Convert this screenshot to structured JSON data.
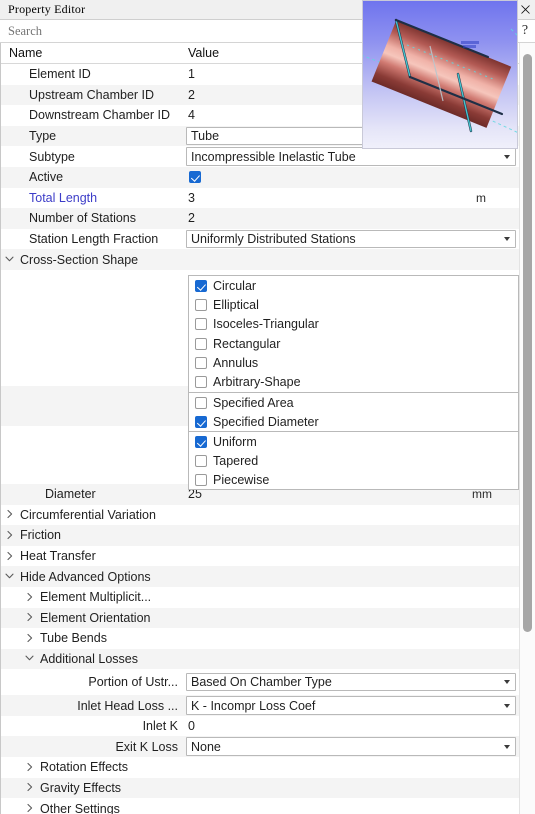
{
  "window": {
    "title": "Property Editor",
    "pin_icon": "pin-icon",
    "close_icon": "close-icon",
    "help_icon": "?"
  },
  "search": {
    "placeholder": "Search",
    "value": ""
  },
  "columns": {
    "name": "Name",
    "value": "Value"
  },
  "rows": [
    {
      "name": "Element ID",
      "value": "1",
      "kind": "text",
      "indent": 1
    },
    {
      "name": "Upstream Chamber ID",
      "value": "2",
      "kind": "text",
      "indent": 1
    },
    {
      "name": "Downstream Chamber ID",
      "value": "4",
      "kind": "text",
      "indent": 1
    },
    {
      "name": "Type",
      "value": "Tube",
      "kind": "combo-noarrow",
      "indent": 1
    },
    {
      "name": "Subtype",
      "value": "Incompressible Inelastic Tube",
      "kind": "combo",
      "indent": 1
    },
    {
      "name": "Active",
      "value": "",
      "kind": "checkbox",
      "checked": true,
      "indent": 1
    },
    {
      "name": "Total Length",
      "value": "3",
      "kind": "text",
      "indent": 1,
      "label_color": "blue",
      "unit": "m"
    },
    {
      "name": "Number of Stations",
      "value": "2",
      "kind": "text",
      "indent": 1
    },
    {
      "name": "Station Length Fraction",
      "value": "Uniformly Distributed Stations",
      "kind": "combo",
      "indent": 1
    }
  ],
  "cross_section": {
    "label": "Cross-Section Shape",
    "expanded": true,
    "shape_options": [
      {
        "label": "Circular",
        "checked": true
      },
      {
        "label": "Elliptical",
        "checked": false
      },
      {
        "label": "Isoceles-Triangular",
        "checked": false
      },
      {
        "label": "Rectangular",
        "checked": false
      },
      {
        "label": "Annulus",
        "checked": false
      },
      {
        "label": "Arbitrary-Shape",
        "checked": false
      }
    ],
    "sizing_options": [
      {
        "label": "Specified Area",
        "checked": false
      },
      {
        "label": "Specified Diameter",
        "checked": true
      }
    ],
    "variation_options": [
      {
        "label": "Uniform",
        "checked": true
      },
      {
        "label": "Tapered",
        "checked": false
      },
      {
        "label": "Piecewise",
        "checked": false
      }
    ],
    "diameter": {
      "name": "Diameter",
      "value": "25",
      "unit": "mm"
    }
  },
  "groups": [
    {
      "label": "Circumferential Variation",
      "expanded": false,
      "indent": 0
    },
    {
      "label": "Friction",
      "expanded": false,
      "indent": 0
    },
    {
      "label": "Heat Transfer",
      "expanded": false,
      "indent": 0
    },
    {
      "label": "Hide Advanced Options",
      "expanded": true,
      "indent": 0
    },
    {
      "label": "Element Multiplicit...",
      "expanded": false,
      "indent": 1
    },
    {
      "label": "Element Orientation",
      "expanded": false,
      "indent": 1
    },
    {
      "label": "Tube Bends",
      "expanded": false,
      "indent": 1
    },
    {
      "label": "Additional Losses",
      "expanded": true,
      "indent": 1
    }
  ],
  "additional_losses": [
    {
      "name": "Portion of Ustr...",
      "value": "Based On Chamber Type",
      "kind": "combo"
    },
    {
      "name": "Inlet Head Loss ...",
      "value": "K - Incompr Loss Coef",
      "kind": "combo"
    },
    {
      "name": "Inlet K",
      "value": "0",
      "kind": "text"
    },
    {
      "name": "Exit K Loss",
      "value": "None",
      "kind": "combo"
    }
  ],
  "trailing_groups": [
    {
      "label": "Rotation Effects",
      "expanded": false,
      "indent": 1
    },
    {
      "label": "Gravity Effects",
      "expanded": false,
      "indent": 1
    },
    {
      "label": "Other Settings",
      "expanded": false,
      "indent": 1
    }
  ],
  "viewport": {
    "name": "3d-model-viewport",
    "object": "tube",
    "background_top": "#6f74ee",
    "background_bottom": "#f0f0fb",
    "surface_color": "#c56a66",
    "highlight_color": "#f0a9a0",
    "axis_color": "#3fd2d2"
  },
  "scrollbar": {
    "thumb_color": "#a6a6a6"
  }
}
